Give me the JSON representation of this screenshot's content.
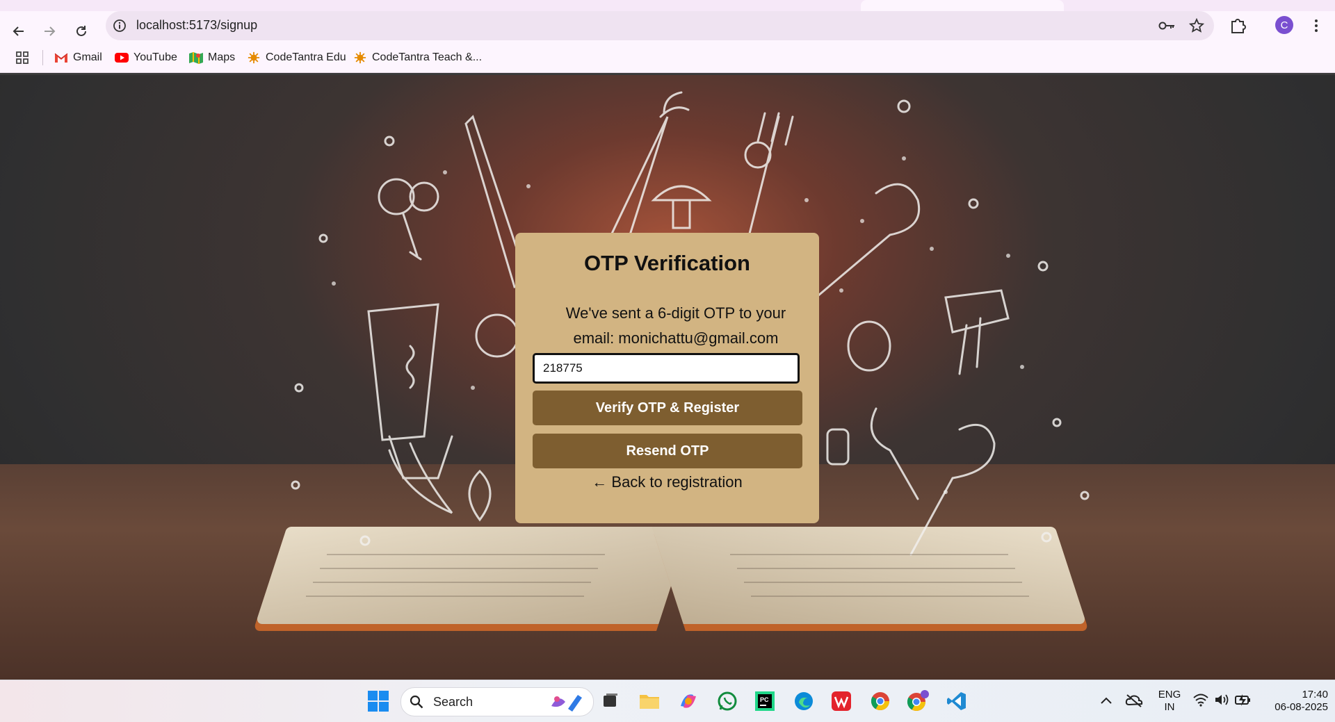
{
  "browser": {
    "url": "localhost:5173/signup",
    "profile_initial": "C",
    "bookmarks": [
      {
        "label": "Gmail",
        "icon": "gmail-icon"
      },
      {
        "label": "YouTube",
        "icon": "youtube-icon"
      },
      {
        "label": "Maps",
        "icon": "maps-icon"
      },
      {
        "label": "CodeTantra Edu",
        "icon": "codetantra-icon"
      },
      {
        "label": "CodeTantra Teach &...",
        "icon": "codetantra-icon"
      }
    ]
  },
  "otp_card": {
    "title": "OTP Verification",
    "message_line1": "We've sent a 6-digit OTP to your",
    "message_line2": "email: monichattu@gmail.com",
    "otp_value": "218775",
    "verify_label": "Verify OTP & Register",
    "resend_label": "Resend OTP",
    "back_label": "← Back to registration"
  },
  "taskbar": {
    "search_placeholder": "Search",
    "language": "ENG",
    "region": "IN",
    "time": "17:40",
    "date": "06-08-2025"
  },
  "colors": {
    "card_bg": "#d2b482",
    "button_bg": "#7e5e30",
    "browser_bg": "#fdf5fe",
    "omnibox_bg": "#efe3f1"
  }
}
